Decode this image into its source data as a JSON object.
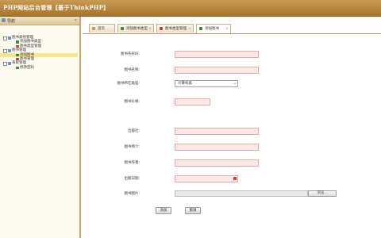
{
  "app": {
    "title": "PHP网站后台管理【基于ThinkPHP】"
  },
  "sidebar": {
    "header": "导航",
    "collapse": "«",
    "items": [
      {
        "label": "图书类别管理",
        "level": 0,
        "icon_color": "#6a8fc0"
      },
      {
        "label": "添加图书类型",
        "level": 1,
        "icon_color": "#3a8a3a"
      },
      {
        "label": "图书类型管理",
        "level": 1,
        "icon_color": "#c04040"
      },
      {
        "label": "图书管理",
        "level": 0,
        "icon_color": "#6a8fc0"
      },
      {
        "label": "添加图书",
        "level": 1,
        "icon_color": "#3a8a3a",
        "selected": true
      },
      {
        "label": "图书管理",
        "level": 1,
        "icon_color": "#c04040"
      },
      {
        "label": "系统管理",
        "level": 0,
        "icon_color": "#6a8fc0"
      },
      {
        "label": "修改密码",
        "level": 1,
        "icon_color": "#3a8a3a"
      }
    ]
  },
  "tabs": [
    {
      "label": "首页",
      "icon_color": "#c89a52"
    },
    {
      "label": "添加图书类型",
      "icon_color": "#3a8a3a"
    },
    {
      "label": "图书类型管理",
      "icon_color": "#c04040"
    },
    {
      "label": "添加图书",
      "icon_color": "#3a8a3a",
      "active": true
    }
  ],
  "form": {
    "fields": [
      {
        "label": "图书条形码:",
        "type": "text",
        "value": ""
      },
      {
        "label": "图书名称:",
        "type": "text",
        "value": ""
      },
      {
        "label": "图书所在类型:",
        "type": "select",
        "value": "计算机类"
      },
      {
        "label": "图书价格:",
        "type": "text-short",
        "value": ""
      },
      {
        "label": "出版社:",
        "type": "text",
        "value": ""
      },
      {
        "label": "图书简介:",
        "type": "text",
        "value": ""
      },
      {
        "label": "图书作者:",
        "type": "text",
        "value": ""
      },
      {
        "label": "出版日期:",
        "type": "date",
        "value": ""
      },
      {
        "label": "图书图片:",
        "type": "file",
        "value": "",
        "browse_label": "浏览..."
      }
    ],
    "submit_label": "添加",
    "reset_label": "重填"
  }
}
